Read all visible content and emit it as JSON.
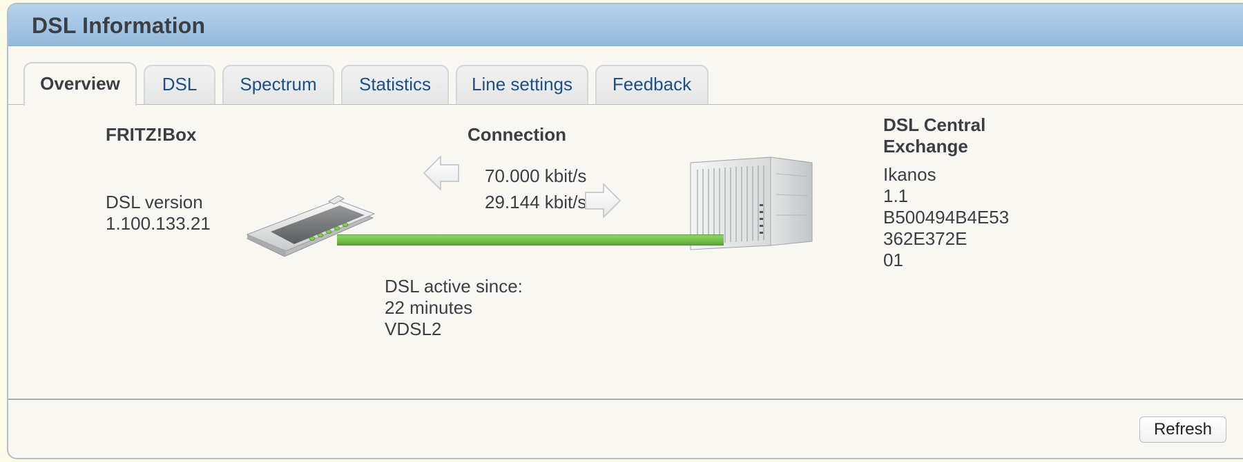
{
  "window": {
    "title": "DSL Information"
  },
  "tabs": [
    {
      "label": "Overview",
      "active": true
    },
    {
      "label": "DSL",
      "active": false
    },
    {
      "label": "Spectrum",
      "active": false
    },
    {
      "label": "Statistics",
      "active": false
    },
    {
      "label": "Line settings",
      "active": false
    },
    {
      "label": "Feedback",
      "active": false
    }
  ],
  "fritzbox": {
    "heading": "FRITZ!Box",
    "version_label": "DSL version",
    "version_value": "1.100.133.21",
    "icon": "router-icon"
  },
  "connection": {
    "heading": "Connection",
    "downstream": "70.000 kbit/s",
    "upstream": "29.144 kbit/s",
    "downstream_icon": "arrow-left-icon",
    "upstream_icon": "arrow-right-icon",
    "cable_color": "#6fbe45",
    "active_label": "DSL active since:",
    "active_duration": "22 minutes",
    "mode": "VDSL2"
  },
  "exchange": {
    "heading_line1": "DSL Central",
    "heading_line2": "Exchange",
    "icon": "server-rack-icon",
    "details": [
      "Ikanos",
      "1.1",
      "B500494B4E53",
      "362E372E",
      "01"
    ]
  },
  "footer": {
    "refresh_label": "Refresh"
  },
  "colors": {
    "title_bar": "#a4c5e3",
    "tab_text": "#1c4f86",
    "panel_bg": "#f8f7f2"
  }
}
